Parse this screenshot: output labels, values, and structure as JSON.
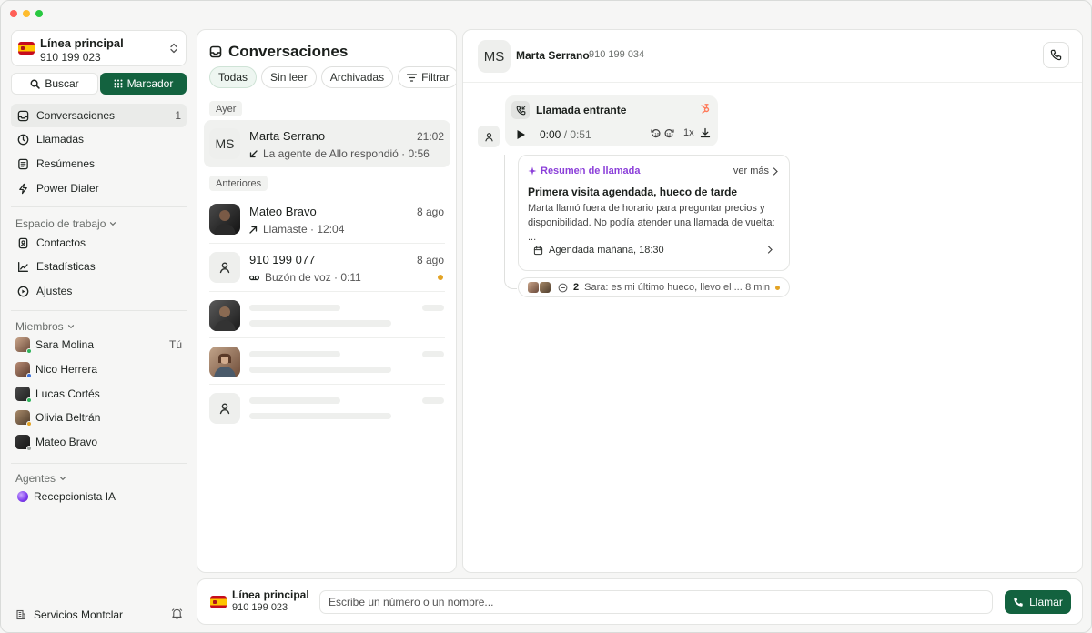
{
  "window": {
    "controls": [
      "close",
      "minimize",
      "zoom"
    ]
  },
  "sidebar": {
    "line": {
      "name": "Línea principal",
      "number": "910 199 023",
      "flag": "spain-flag-icon"
    },
    "search_label": "Buscar",
    "dialer_label": "Marcador",
    "nav": [
      {
        "label": "Conversaciones",
        "count": "1",
        "icon": "inbox-icon",
        "active": true
      },
      {
        "label": "Llamadas",
        "icon": "clock-icon"
      },
      {
        "label": "Resúmenes",
        "icon": "document-list-icon"
      },
      {
        "label": "Power Dialer",
        "icon": "bolt-icon"
      }
    ],
    "workspace_heading": "Espacio de trabajo",
    "workspace": [
      {
        "label": "Contactos",
        "icon": "contact-book-icon"
      },
      {
        "label": "Estadísticas",
        "icon": "chart-line-icon"
      },
      {
        "label": "Ajustes",
        "icon": "settings-icon"
      }
    ],
    "members_heading": "Miembros",
    "members": [
      {
        "name": "Sara Molina",
        "tag": "Tú",
        "status_color": "#2fb35c"
      },
      {
        "name": "Nico Herrera",
        "status_color": "#3b6fd8"
      },
      {
        "name": "Lucas Cortés",
        "status_color": "#2fb35c"
      },
      {
        "name": "Olivia Beltrán",
        "status_color": "#e3a324"
      },
      {
        "name": "Mateo Bravo",
        "status_color": "#9ca3a0"
      }
    ],
    "agents_heading": "Agentes",
    "agents": [
      {
        "name": "Recepcionista IA"
      }
    ],
    "footer": {
      "company": "Servicios Montclar"
    }
  },
  "conversations": {
    "title": "Conversaciones",
    "filters": [
      "Todas",
      "Sin leer",
      "Archivadas",
      "Filtrar"
    ],
    "active_filter": "Todas",
    "groups": [
      {
        "label": "Ayer",
        "items": [
          {
            "initials": "MS",
            "name": "Marta Serrano",
            "time": "21:02",
            "subtitle": "La agente de Allo respondió · 0:56",
            "icon": "arrow-incoming-icon",
            "selected": true
          }
        ]
      },
      {
        "label": "Anteriores",
        "items": [
          {
            "name": "Mateo Bravo",
            "time": "8 ago",
            "subtitle": "Llamaste · 12:04",
            "icon": "arrow-outgoing-icon"
          },
          {
            "name": "910 199 077",
            "time": "8 ago",
            "subtitle": "Buzón de voz · 0:11",
            "icon": "voicemail-icon",
            "unread": true
          }
        ]
      }
    ]
  },
  "detail": {
    "contact": {
      "initials": "MS",
      "name": "Marta Serrano",
      "number": "910 199 034"
    },
    "call": {
      "title": "Llamada entrante",
      "time_current": "0:00",
      "time_total": "/ 0:51",
      "speed": "1x"
    },
    "summary": {
      "label": "Resumen de llamada",
      "more": "ver más",
      "title": "Primera visita agendada, hueco de tarde",
      "body": "Marta llamó fuera de horario para preguntar precios y disponibilidad. No podía atender una llamada de vuelta: ...",
      "item": "Agendada mañana, 18:30"
    },
    "comments": {
      "count": "2",
      "snippet": "Sara: es mi último hueco, llevo el ...",
      "ago": "8 min"
    }
  },
  "bottom_bar": {
    "line_name": "Línea principal",
    "line_number": "910 199 023",
    "input_placeholder": "Escribe un número o un nombre...",
    "call_label": "Llamar"
  },
  "colors": {
    "brand_green": "#13623f",
    "summary_purple": "#8b3fd9",
    "unread_amber": "#e3a324"
  }
}
